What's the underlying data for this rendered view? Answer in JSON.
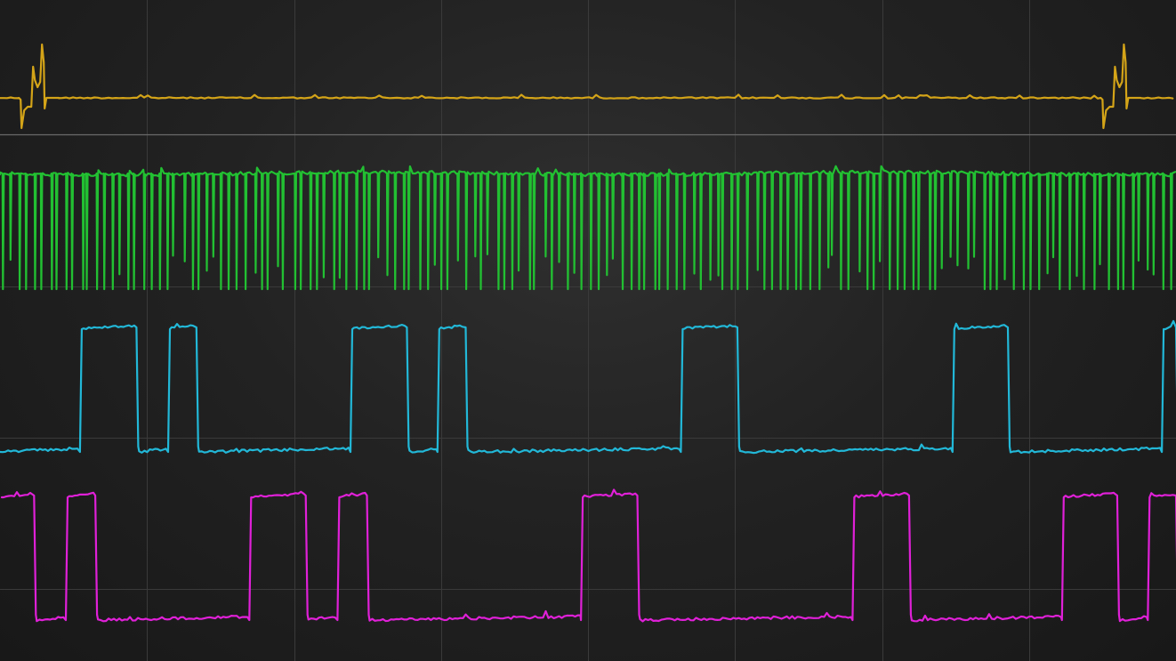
{
  "chart_data": {
    "type": "line",
    "title": "",
    "xlabel": "",
    "ylabel": "",
    "grid": true,
    "x_divisions": 8,
    "colors": {
      "ch1": "#d4a418",
      "ch2": "#22c032",
      "ch3": "#22b8d8",
      "ch4": "#e020d8",
      "grid": "#3a3a3a",
      "divider": "#6a6a6a"
    },
    "series": [
      {
        "kind": "idle-with-bursts",
        "channel": "ch1",
        "color": "#d4a418",
        "baseline": 0.5,
        "bursts": [
          {
            "start": 0.016,
            "end": 0.05
          },
          {
            "start": 0.936,
            "end": 0.97
          }
        ]
      },
      {
        "kind": "spike-train",
        "channel": "ch2",
        "color": "#22c032",
        "high_level": 1.0,
        "low_level": 0.0,
        "spike_count": 150
      },
      {
        "kind": "digital",
        "channel": "ch3",
        "color": "#22b8d8",
        "high_level": 1.0,
        "low_level": 0.0,
        "high_intervals": [
          [
            0.068,
            0.116
          ],
          [
            0.143,
            0.167
          ],
          [
            0.298,
            0.346
          ],
          [
            0.372,
            0.396
          ],
          [
            0.579,
            0.627
          ],
          [
            0.81,
            0.857
          ],
          [
            0.988,
            1.0
          ]
        ]
      },
      {
        "kind": "digital",
        "channel": "ch4",
        "color": "#e020d8",
        "high_level": 1.0,
        "low_level": 0.0,
        "high_intervals": [
          [
            0.0,
            0.029
          ],
          [
            0.056,
            0.081
          ],
          [
            0.212,
            0.26
          ],
          [
            0.287,
            0.312
          ],
          [
            0.494,
            0.542
          ],
          [
            0.725,
            0.773
          ],
          [
            0.903,
            0.95
          ],
          [
            0.976,
            1.0
          ]
        ]
      }
    ]
  }
}
